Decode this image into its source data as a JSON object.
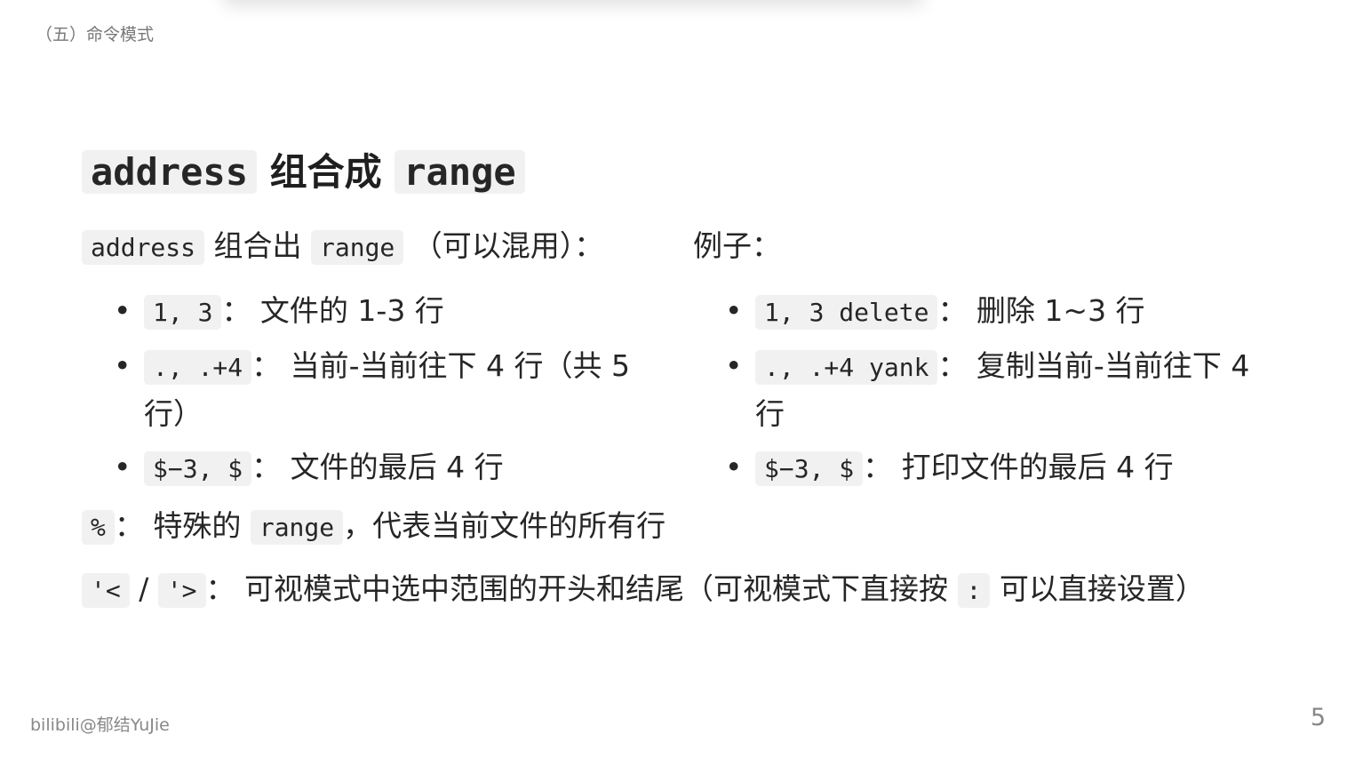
{
  "header": {
    "section_label": "（五）命令模式"
  },
  "heading": {
    "part1": "address",
    "part2": " 组合成 ",
    "part3": "range"
  },
  "intro": {
    "code1": "address",
    "text1": " 组合出 ",
    "code2": "range",
    "text2": " （可以混用）：",
    "examples_label": "例子："
  },
  "left_list": [
    {
      "code": "1, 3",
      "text": "：  文件的 1-3 行"
    },
    {
      "code": "., .+4",
      "text": "：  当前-当前往下 4 行（共 5 行）"
    },
    {
      "code": "$−3, $",
      "text": "：  文件的最后 4 行"
    }
  ],
  "right_list": [
    {
      "code": "1, 3 delete",
      "text": "：  删除 1~3 行"
    },
    {
      "code": "., .+4 yank",
      "text": "：  复制当前-当前往下 4 行"
    },
    {
      "code": "$−3, $",
      "text": "：  打印文件的最后 4 行"
    }
  ],
  "percent_line": {
    "code1": "%",
    "text1": "：  特殊的 ",
    "code2": "range",
    "text2": "，代表当前文件的所有行"
  },
  "visual_line": {
    "code1": "'<",
    "sep": " / ",
    "code2": "'>",
    "text1": "：  可视模式中选中范围的开头和结尾（可视模式下直接按 ",
    "code3": ":",
    "text2": " 可以直接设置）"
  },
  "footer": {
    "credit": "bilibili@郁结YuJie",
    "page_number": "5"
  },
  "bullet_char": "•"
}
